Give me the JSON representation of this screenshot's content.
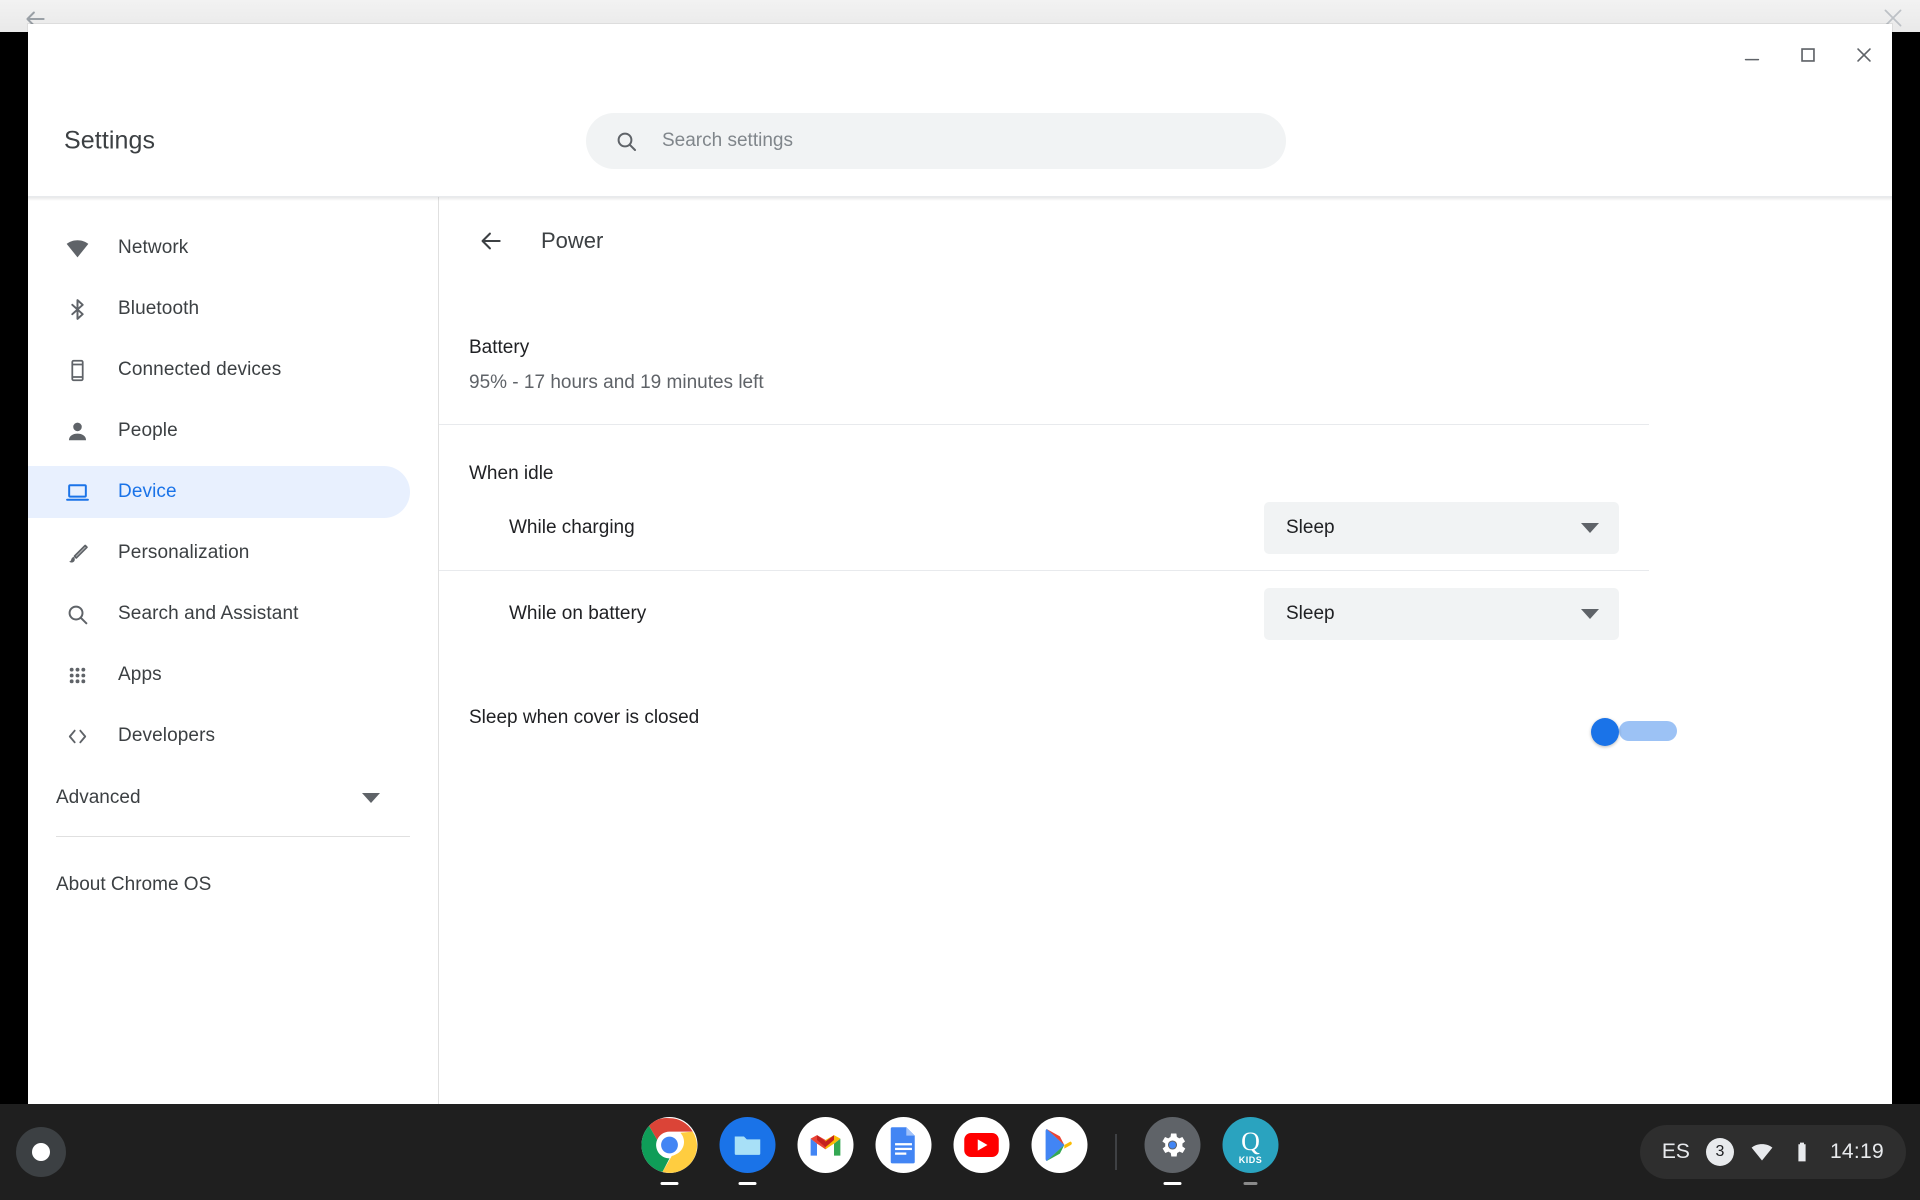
{
  "desktop": {
    "back_icon": "back-arrow-icon",
    "close_icon": "close-icon"
  },
  "window": {
    "controls": {
      "minimize_label": "Minimize",
      "maximize_label": "Maximize",
      "close_label": "Close"
    }
  },
  "header": {
    "title": "Settings",
    "search": {
      "placeholder": "Search settings",
      "value": "",
      "icon": "search-icon"
    }
  },
  "sidebar": {
    "items": [
      {
        "label": "Network",
        "icon": "wifi-icon",
        "active": false
      },
      {
        "label": "Bluetooth",
        "icon": "bluetooth-icon",
        "active": false
      },
      {
        "label": "Connected devices",
        "icon": "phone-icon",
        "active": false
      },
      {
        "label": "People",
        "icon": "person-icon",
        "active": false
      },
      {
        "label": "Device",
        "icon": "laptop-icon",
        "active": true
      },
      {
        "label": "Personalization",
        "icon": "brush-icon",
        "active": false
      },
      {
        "label": "Search and Assistant",
        "icon": "search-icon",
        "active": false
      },
      {
        "label": "Apps",
        "icon": "grid-apps-icon",
        "active": false
      },
      {
        "label": "Developers",
        "icon": "code-brackets-icon",
        "active": false
      }
    ],
    "advanced": {
      "label": "Advanced",
      "icon": "chevron-down-icon"
    },
    "about": {
      "label": "About Chrome OS"
    }
  },
  "main": {
    "back_icon": "back-arrow-icon",
    "page_title": "Power",
    "battery": {
      "title": "Battery",
      "status": "95% - 17 hours and 19 minutes left",
      "percent": "95%",
      "time_left": "17 hours and 19 minutes left"
    },
    "when_idle": {
      "section_label": "When idle",
      "rows": [
        {
          "label": "While charging",
          "value": "Sleep",
          "caret": "chevron-down-icon"
        },
        {
          "label": "While on battery",
          "value": "Sleep",
          "caret": "chevron-down-icon"
        }
      ]
    },
    "cover": {
      "label": "Sleep when cover is closed",
      "toggle_on": true
    }
  },
  "shelf": {
    "launcher": {
      "name": "launcher-button"
    },
    "apps": [
      {
        "name": "chrome",
        "label": "Chrome",
        "running": true
      },
      {
        "name": "files",
        "label": "Files",
        "running": true
      },
      {
        "name": "gmail",
        "label": "Gmail",
        "running": false
      },
      {
        "name": "docs",
        "label": "Docs",
        "running": false
      },
      {
        "name": "youtube",
        "label": "YouTube",
        "running": false
      },
      {
        "name": "play-store",
        "label": "Play Store",
        "running": false
      },
      {
        "name": "settings",
        "label": "Settings",
        "running": true
      },
      {
        "name": "q-kids",
        "label": "KIDS",
        "running": true
      }
    ],
    "tray": {
      "locale": "ES",
      "notification_count": "3",
      "wifi_icon": "wifi-icon",
      "battery_icon": "battery-icon",
      "time": "14:19"
    }
  },
  "colors": {
    "accent": "#1a73e8",
    "active_bg": "#e8f0fe",
    "text_primary": "#202124",
    "text_secondary": "#5f6368",
    "control_bg": "#f1f3f4",
    "shelf_bg": "#1f1f1f"
  }
}
